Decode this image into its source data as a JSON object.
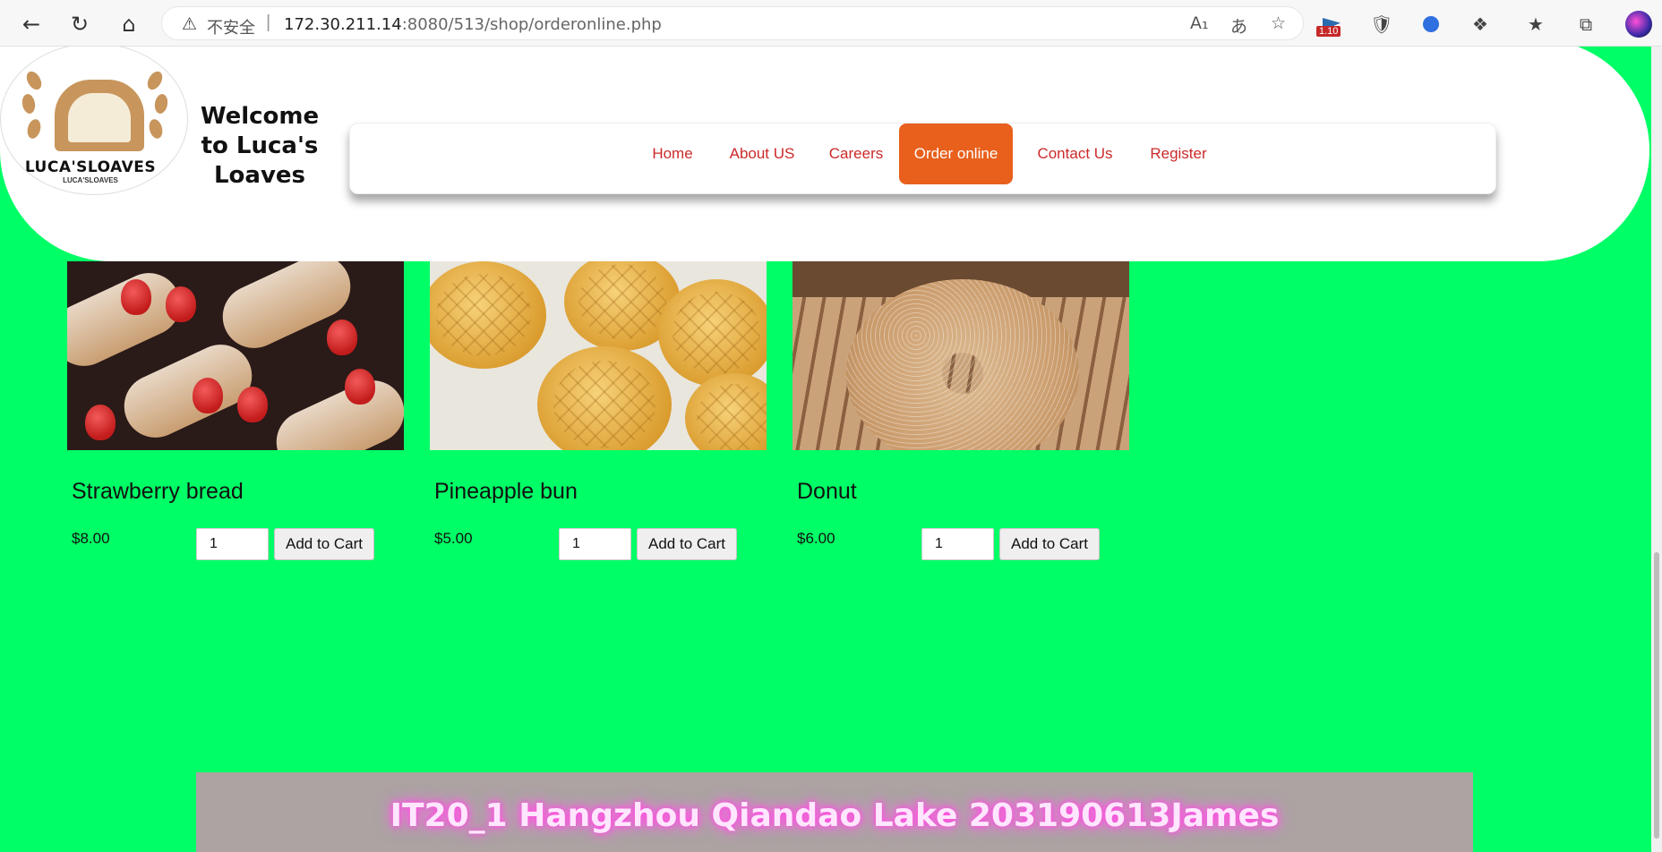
{
  "browser": {
    "security_label": "不安全",
    "url_host": "172.30.211.14",
    "url_rest": ":8080/513/shop/orderonline.php",
    "extension_badge": "1.10",
    "icons": [
      "back-icon",
      "refresh-icon",
      "home-icon",
      "warning-icon",
      "read-aloud-icon",
      "translate-icon",
      "add-favorite-icon",
      "flag-extension-icon",
      "shield-extension-icon",
      "edge-extension-icon",
      "extensions-icon",
      "favorites-icon",
      "collections-icon",
      "profile-avatar"
    ]
  },
  "header": {
    "logo_text": "LUCA'SLOAVES",
    "logo_subtext": "LUCA'SLOAVES",
    "welcome": "Welcome to Luca's Loaves"
  },
  "nav": {
    "items": [
      {
        "label": "Home",
        "active": false
      },
      {
        "label": "About US",
        "active": false
      },
      {
        "label": "Careers",
        "active": false
      },
      {
        "label": "Order online",
        "active": true
      },
      {
        "label": "Contact Us",
        "active": false
      },
      {
        "label": "Register",
        "active": false
      }
    ],
    "active_color": "#e8601c",
    "link_color": "#cc2a2a"
  },
  "products": [
    {
      "name": "Strawberry bread",
      "price": "$8.00",
      "qty": "1",
      "button": "Add to Cart",
      "image": "strawberry-croissants"
    },
    {
      "name": "Pineapple bun",
      "price": "$5.00",
      "qty": "1",
      "button": "Add to Cart",
      "image": "pineapple-buns"
    },
    {
      "name": "Donut",
      "price": "$6.00",
      "qty": "1",
      "button": "Add to Cart",
      "image": "sesame-bagel"
    }
  ],
  "footer": {
    "text": "IT20_1 Hangzhou Qiandao Lake 203190613James"
  },
  "colors": {
    "page_background": "#00ff66",
    "footer_background": "#aca3a2"
  }
}
